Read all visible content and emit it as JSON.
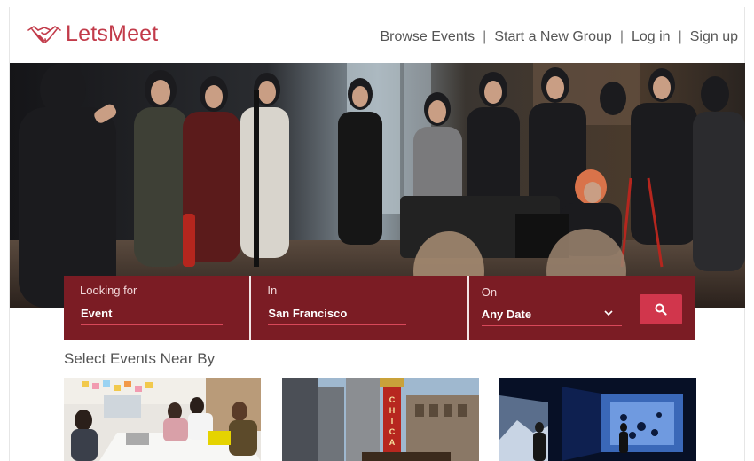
{
  "header": {
    "logo_text": "LetsMeet",
    "nav": {
      "browse": "Browse Events",
      "start": "Start a New Group",
      "login": "Log in",
      "signup": "Sign up",
      "separator": "|"
    }
  },
  "search": {
    "looking_for": {
      "label": "Looking for",
      "value": "Event"
    },
    "in": {
      "label": "In",
      "value": "San Francisco"
    },
    "on": {
      "label": "On",
      "value": "Any Date"
    },
    "button_icon": "search-icon"
  },
  "nearby": {
    "title": "Select Events Near By",
    "cards": [
      {
        "image": "office-meeting-photo"
      },
      {
        "image": "chicago-theatre-street-photo"
      },
      {
        "image": "projection-art-exhibit-photo"
      }
    ]
  },
  "hero": {
    "image": "crowd-at-event-photo"
  },
  "colors": {
    "brand": "#c23b4a",
    "search_bar": "#7b1c24",
    "search_button": "#d1364c",
    "nav_text": "#555555"
  }
}
